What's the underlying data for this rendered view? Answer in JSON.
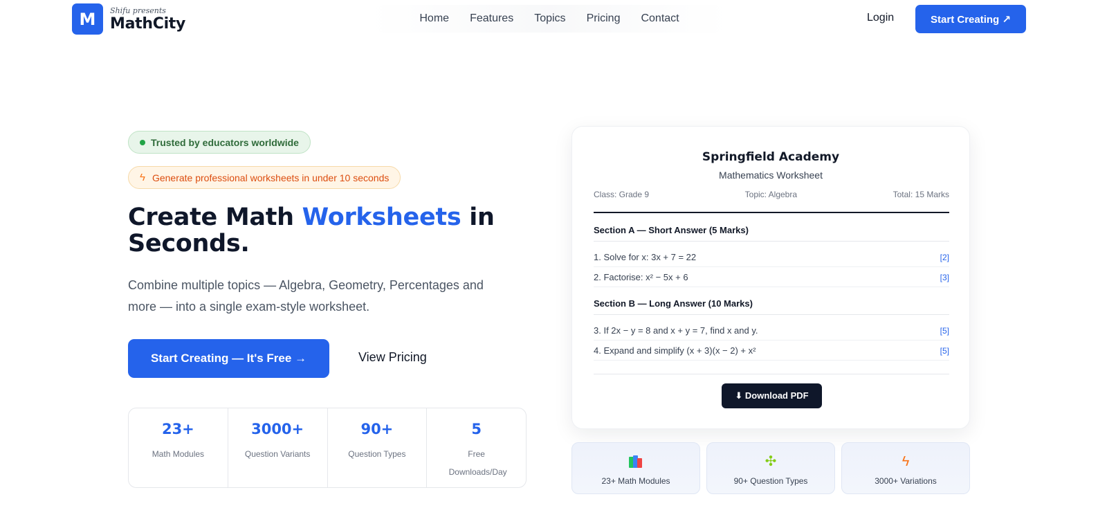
{
  "brand": {
    "logo_letter": "M",
    "tagline": "Shifu presents",
    "name": "MathCity",
    "accent_color": "#2563eb"
  },
  "nav": {
    "links": [
      "Home",
      "Features",
      "Topics",
      "Pricing",
      "Contact"
    ],
    "login": "Login",
    "cta": "Start Creating ↗"
  },
  "hero": {
    "trusted_badge": "Trusted by educators worldwide",
    "speed_badge": "Generate professional worksheets in under 10 seconds",
    "title_part1": "Create Math ",
    "title_accent": "Worksheets",
    "title_part2": " in Seconds.",
    "subtitle": "Combine multiple topics — Algebra, Geometry, Percentages and more — into a single exam-style worksheet.",
    "primary_cta": "Start Creating — It's Free →",
    "secondary_cta": "View Pricing"
  },
  "stats": [
    {
      "value": "23+",
      "label": "Math Modules"
    },
    {
      "value": "3000+",
      "label": "Question Variants"
    },
    {
      "value": "90+",
      "label": "Question Types"
    },
    {
      "value": "5",
      "label": "Free Downloads/Day"
    }
  ],
  "worksheet": {
    "school": "Springfield Academy",
    "title": "Mathematics Worksheet",
    "class": "Class: Grade 9",
    "topic": "Topic: Algebra",
    "total": "Total: 15 Marks",
    "section_a": "Section A — Short Answer (5 Marks)",
    "section_b": "Section B — Long Answer (10 Marks)",
    "questions": [
      {
        "text": "1. Solve for x: 3x + 7 = 22",
        "marks": "[2]"
      },
      {
        "text": "2. Factorise: x² − 5x + 6",
        "marks": "[3]"
      },
      {
        "text": "3. If 2x − y = 8 and x + y = 7, find x and y.",
        "marks": "[5]"
      },
      {
        "text": "4. Expand and simplify (x + 3)(x − 2) + x²",
        "marks": "[5]"
      }
    ],
    "download": "⬇ Download PDF"
  },
  "features": [
    {
      "icon": "books-icon",
      "label": "23+ Math Modules"
    },
    {
      "icon": "puzzle-icon",
      "label": "90+ Question Types"
    },
    {
      "icon": "lightning-icon",
      "label": "3000+ Variations"
    }
  ]
}
